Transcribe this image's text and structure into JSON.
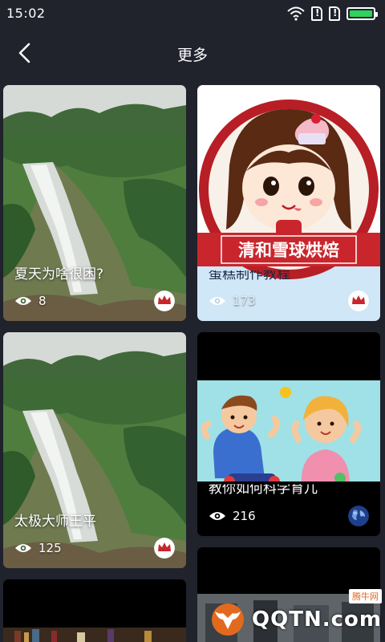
{
  "status": {
    "time": "15:02",
    "battery_level": 1.0
  },
  "header": {
    "title": "更多"
  },
  "cards": [
    {
      "title": "夏天为啥很困?",
      "views": "8",
      "author_icon": "red-crown-avatar"
    },
    {
      "title": "蛋糕制作教程",
      "banner": "清和雪球烘焙",
      "views": "173",
      "author_icon": "red-crown-avatar"
    },
    {
      "title": "太极大师王平",
      "views": "125",
      "author_icon": "red-crown-avatar"
    },
    {
      "title": "教你如何科学育儿",
      "views": "216",
      "author_icon": "earth-avatar"
    }
  ],
  "watermark": {
    "text": "QQTN.com",
    "label": "腾牛网"
  },
  "colors": {
    "background": "#20222c",
    "accent_red": "#c8262c",
    "card_blue": "#cfe7f7"
  }
}
